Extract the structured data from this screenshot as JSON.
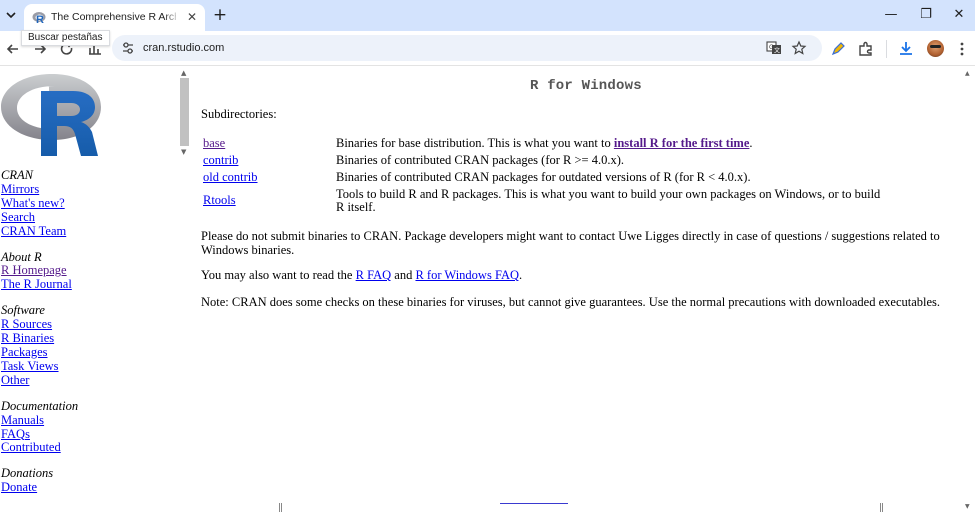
{
  "browser": {
    "tab_title": "The Comprehensive R Archive Network",
    "tooltip": "Buscar pestañas",
    "url": "cran.rstudio.com",
    "new_tab_symbol": "+",
    "minimize_symbol": "—",
    "restore_symbol": "❐",
    "close_symbol": "✕",
    "tab_close_symbol": "✕"
  },
  "sidebar": {
    "groups": [
      {
        "heading": "CRAN",
        "links": [
          {
            "label": "Mirrors"
          },
          {
            "label": "What's new?"
          },
          {
            "label": "Search"
          },
          {
            "label": "CRAN Team"
          }
        ]
      },
      {
        "heading": "About R",
        "links": [
          {
            "label": "R Homepage"
          },
          {
            "label": "The R Journal"
          }
        ]
      },
      {
        "heading": "Software",
        "links": [
          {
            "label": "R Sources"
          },
          {
            "label": "R Binaries"
          },
          {
            "label": "Packages"
          },
          {
            "label": "Task Views"
          },
          {
            "label": "Other"
          }
        ]
      },
      {
        "heading": "Documentation",
        "links": [
          {
            "label": "Manuals"
          },
          {
            "label": "FAQs"
          },
          {
            "label": "Contributed"
          }
        ]
      },
      {
        "heading": "Donations",
        "links": [
          {
            "label": "Donate"
          }
        ]
      }
    ]
  },
  "main": {
    "title": "R for Windows",
    "subdirectories_label": "Subdirectories:",
    "dirs": [
      {
        "name": "base",
        "desc_prefix": "Binaries for base distribution. This is what you want to ",
        "desc_link": "install R for the first time",
        "desc_suffix": "."
      },
      {
        "name": "contrib",
        "desc": "Binaries of contributed CRAN packages (for R >= 4.0.x)."
      },
      {
        "name": "old contrib",
        "desc": "Binaries of contributed CRAN packages for outdated versions of R (for R < 4.0.x)."
      },
      {
        "name": "Rtools",
        "desc": "Tools to build R and R packages. This is what you want to build your own packages on Windows, or to build R itself."
      }
    ],
    "para1": "Please do not submit binaries to CRAN. Package developers might want to contact Uwe Ligges directly in case of questions / suggestions related to Windows binaries.",
    "para2_prefix": "You may also want to read the ",
    "para2_link1": "R FAQ",
    "para2_mid": " and ",
    "para2_link2": "R for Windows FAQ",
    "para2_suffix": ".",
    "para3": "Note: CRAN does some checks on these binaries for viruses, but cannot give guarantees. Use the normal precautions with downloaded executables."
  }
}
